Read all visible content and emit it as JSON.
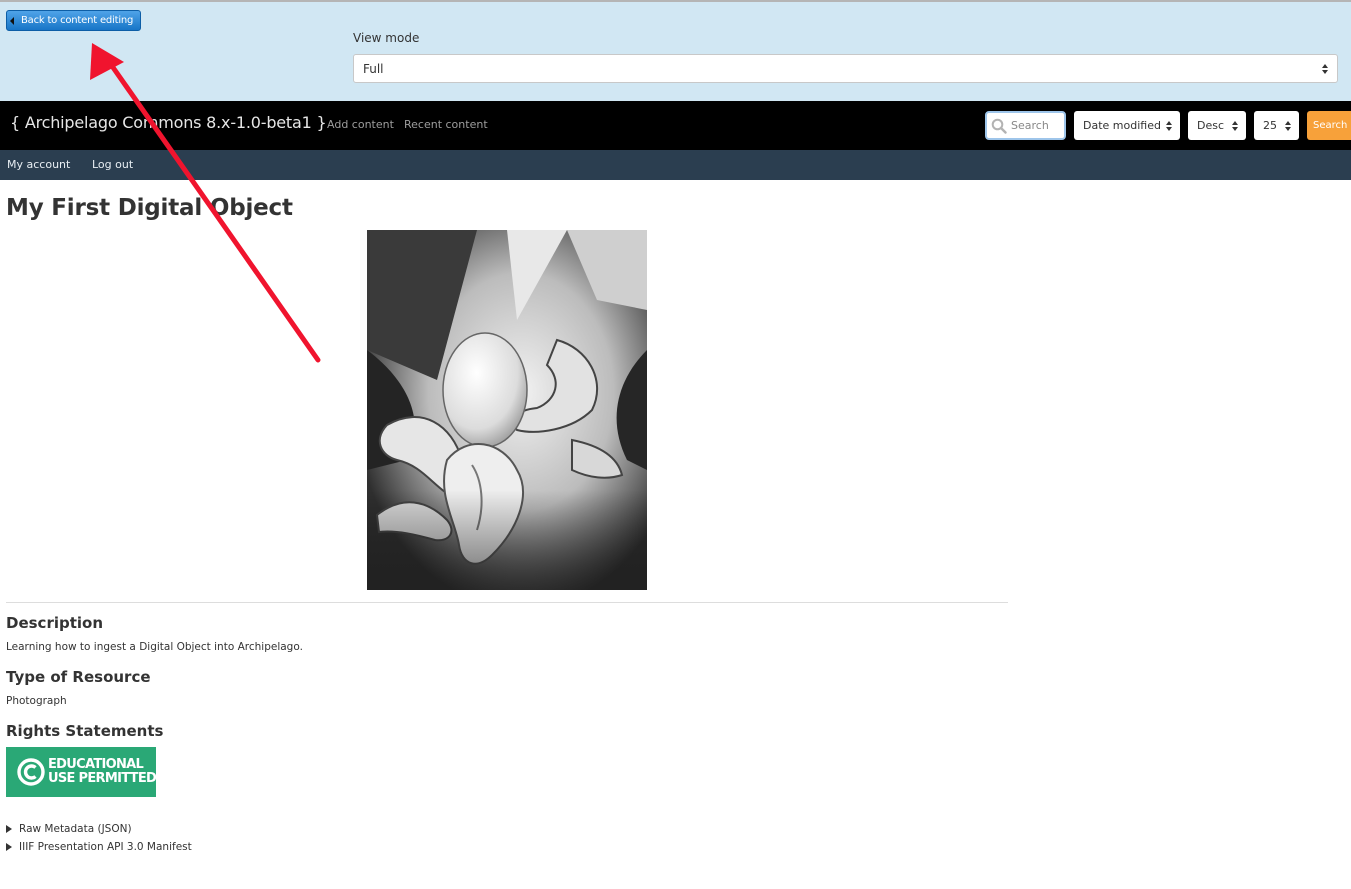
{
  "preview_bar": {
    "back_label": "Back to content editing",
    "view_mode_label": "View mode",
    "view_mode_value": "Full"
  },
  "navbar": {
    "brand": "{ Archipelago Commons 8.x-1.0-beta1 }",
    "links": [
      "Add content",
      "Recent content"
    ],
    "search_placeholder": "Search",
    "sort_field": "Date modified",
    "sort_order": "Desc",
    "per_page": "25",
    "search_button": "Search"
  },
  "subnav": {
    "links": [
      "My account",
      "Log out"
    ]
  },
  "main": {
    "title": "My First Digital Object",
    "fields": [
      {
        "label": "Description",
        "value": "Learning how to ingest a Digital Object into Archipelago."
      },
      {
        "label": "Type of Resource",
        "value": "Photograph"
      },
      {
        "label": "Rights Statements"
      }
    ],
    "rights_badge": {
      "line1": "EDUCATIONAL",
      "line2": "USE PERMITTED"
    },
    "details": [
      "Raw Metadata (JSON)",
      "IIIF Presentation API 3.0 Manifest"
    ]
  },
  "colors": {
    "preview_bg": "#d1e7f3",
    "navbar_bg": "#000000",
    "subnav_bg": "#2b3e50",
    "search_button": "#f7a13a",
    "rights_badge": "#2aa876",
    "annotation_arrow": "#f0142e"
  },
  "icons": {
    "back": "chevron-left-icon",
    "search": "magnifier-icon",
    "select": "updown-caret-icon",
    "rights": "copyright-icon",
    "disclosure": "triangle-right-icon"
  }
}
